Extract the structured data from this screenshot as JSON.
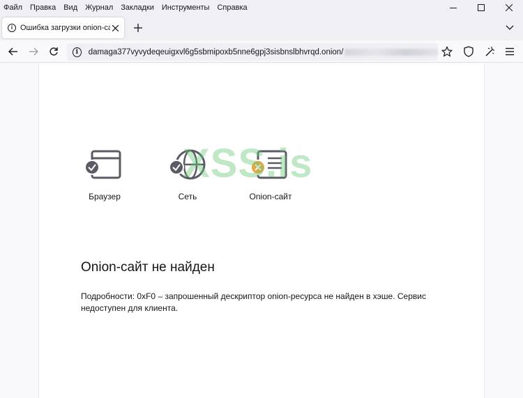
{
  "menubar": {
    "items": [
      "Файл",
      "Правка",
      "Вид",
      "Журнал",
      "Закладки",
      "Инструменты",
      "Справка"
    ]
  },
  "window_controls": [
    "minimize-icon",
    "maximize-icon",
    "close-icon"
  ],
  "tab": {
    "title": "Ошибка загрузки onion-сайта",
    "icon": "info-icon"
  },
  "navbar": {
    "url": "damaga377vyvydeqeuigxvl6g5sbmipoxb5nne6gpj3sisbnslbhvrqd.onion/",
    "icons": [
      "back-icon",
      "forward-icon",
      "reload-icon",
      "info-icon",
      "bookmark-star-icon",
      "shield-icon",
      "extensions-icon",
      "menu-icon"
    ]
  },
  "watermark": "XSS.is",
  "steps": [
    {
      "label": "Браузер",
      "status": "ok"
    },
    {
      "label": "Сеть",
      "status": "ok"
    },
    {
      "label": "Onion-сайт",
      "status": "error"
    }
  ],
  "colors": {
    "ok": "#5b5b66",
    "error": "#f0a340",
    "watermark": "#68c878"
  },
  "error": {
    "title": "Onion-сайт не найден",
    "details": "Подробности: 0xF0 – запрошенный дескриптор onion-ресурса не найден в хэше. Сервис недоступен для клиента."
  }
}
